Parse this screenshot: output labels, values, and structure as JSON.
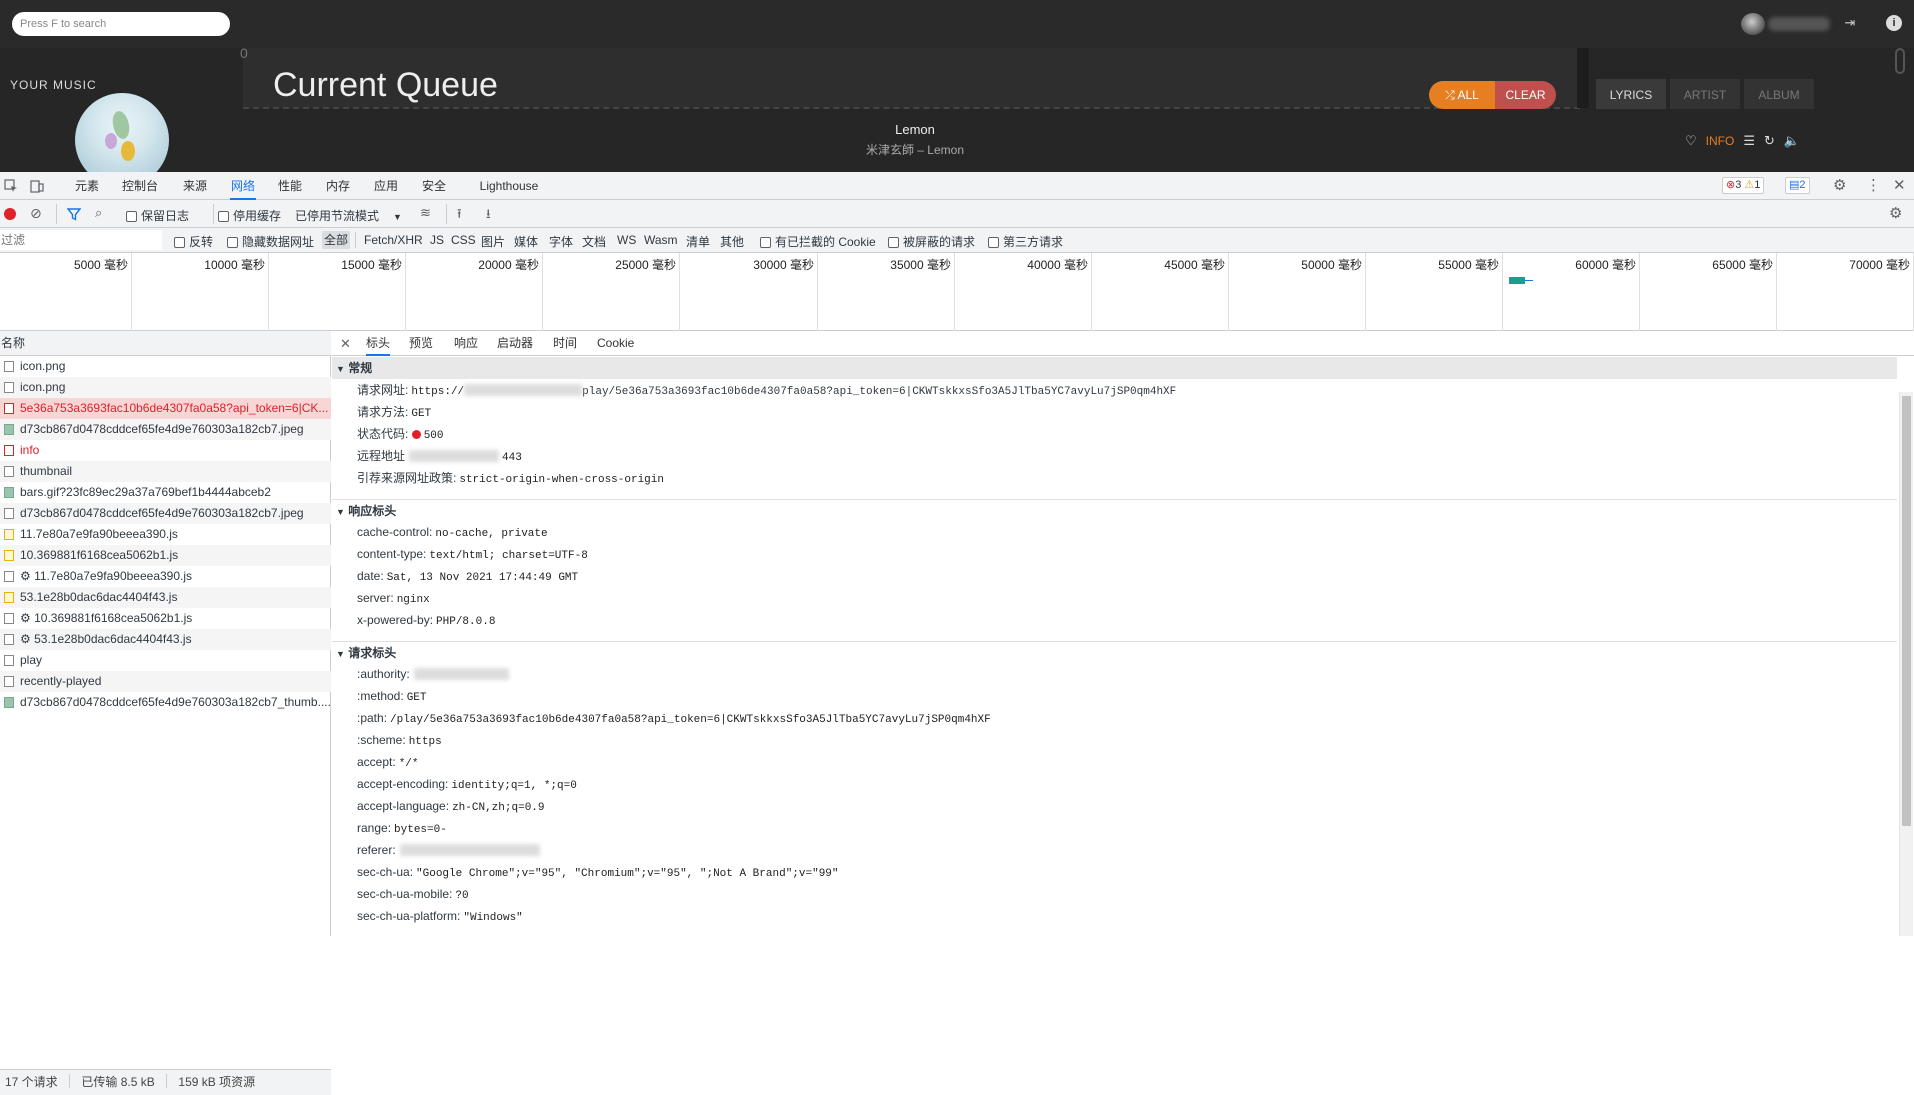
{
  "app": {
    "search_placeholder": "Press F to search",
    "your_music": "YOUR MUSIC",
    "queue_title": "Current Queue",
    "queue_zero": "0",
    "btn_all": "ALL",
    "btn_clear": "CLEAR",
    "tabs": [
      "LYRICS",
      "ARTIST",
      "ALBUM"
    ],
    "song_title": "Lemon",
    "song_sub": "米津玄師 – Lemon",
    "info_label": "INFO",
    "colors": {
      "accent": "#e67e22",
      "clear": "#c0504d",
      "bg": "#262626"
    }
  },
  "devtools": {
    "tabs": [
      "元素",
      "控制台",
      "来源",
      "网络",
      "性能",
      "内存",
      "应用",
      "安全",
      "Lighthouse"
    ],
    "active_tab": "网络",
    "badges": {
      "errors": "3",
      "warnings": "1",
      "messages": "2"
    },
    "toolbar": {
      "preserve_log": "保留日志",
      "disable_cache": "停用缓存",
      "throttle": "已停用节流模式"
    },
    "filter": {
      "placeholder": "过滤",
      "invert": "反转",
      "hide_data_urls": "隐藏数据网址",
      "types": [
        "全部",
        "Fetch/XHR",
        "JS",
        "CSS",
        "图片",
        "媒体",
        "字体",
        "文档",
        "WS",
        "Wasm",
        "清单",
        "其他"
      ],
      "blocked_cookies": "有已拦截的 Cookie",
      "blocked_requests": "被屏蔽的请求",
      "third_party": "第三方请求"
    },
    "timeline_ticks": [
      "5000 毫秒",
      "10000 毫秒",
      "15000 毫秒",
      "20000 毫秒",
      "25000 毫秒",
      "30000 毫秒",
      "35000 毫秒",
      "40000 毫秒",
      "45000 毫秒",
      "50000 毫秒",
      "55000 毫秒",
      "60000 毫秒",
      "65000 毫秒",
      "70000 毫秒"
    ],
    "list_header": "名称",
    "requests": [
      {
        "name": "icon.png",
        "kind": "doc"
      },
      {
        "name": "icon.png",
        "kind": "doc"
      },
      {
        "name": "5e36a753a3693fac10b6de4307fa0a58?api_token=6|CK...",
        "kind": "err"
      },
      {
        "name": "d73cb867d0478cddcef65fe4d9e760303a182cb7.jpeg",
        "kind": "img"
      },
      {
        "name": "info",
        "kind": "err"
      },
      {
        "name": "thumbnail",
        "kind": "doc"
      },
      {
        "name": "bars.gif?23fc89ec29a37a769bef1b4444abceb2",
        "kind": "img"
      },
      {
        "name": "d73cb867d0478cddcef65fe4d9e760303a182cb7.jpeg",
        "kind": "doc"
      },
      {
        "name": "11.7e80a7e9fa90beeea390.js",
        "kind": "js"
      },
      {
        "name": "10.369881f6168cea5062b1.js",
        "kind": "js"
      },
      {
        "name": "⚙ 11.7e80a7e9fa90beeea390.js",
        "kind": "doc"
      },
      {
        "name": "53.1e28b0dac6dac4404f43.js",
        "kind": "js"
      },
      {
        "name": "⚙ 10.369881f6168cea5062b1.js",
        "kind": "doc"
      },
      {
        "name": "⚙ 53.1e28b0dac6dac4404f43.js",
        "kind": "doc"
      },
      {
        "name": "play",
        "kind": "doc"
      },
      {
        "name": "recently-played",
        "kind": "doc"
      },
      {
        "name": "d73cb867d0478cddcef65fe4d9e760303a182cb7_thumb....",
        "kind": "img"
      }
    ],
    "status": {
      "requests": "17 个请求",
      "transferred": "已传输 8.5 kB",
      "resources": "159 kB 项资源"
    },
    "detail_tabs": [
      "标头",
      "预览",
      "响应",
      "启动器",
      "时间",
      "Cookie"
    ],
    "general": {
      "title": "常规",
      "url_label": "请求网址:",
      "url_prefix": "https://",
      "url_suffix": "play/5e36a753a3693fac10b6de4307fa0a58?api_token=6|CKWTskkxsSfo3A5JlTba5YC7avyLu7jSP0qm4hXF",
      "method_label": "请求方法:",
      "method": "GET",
      "status_label": "状态代码:",
      "status": "500",
      "remote_label": "远程地址",
      "remote_suffix": "443",
      "referrer_label": "引荐来源网址政策:",
      "referrer": "strict-origin-when-cross-origin"
    },
    "response_headers": {
      "title": "响应标头",
      "items": [
        {
          "k": "cache-control:",
          "v": "no-cache, private"
        },
        {
          "k": "content-type:",
          "v": "text/html; charset=UTF-8"
        },
        {
          "k": "date:",
          "v": "Sat, 13 Nov 2021 17:44:49 GMT"
        },
        {
          "k": "server:",
          "v": "nginx"
        },
        {
          "k": "x-powered-by:",
          "v": "PHP/8.0.8"
        }
      ]
    },
    "request_headers": {
      "title": "请求标头",
      "items": [
        {
          "k": ":authority:",
          "v": ""
        },
        {
          "k": ":method:",
          "v": "GET"
        },
        {
          "k": ":path:",
          "v": "/play/5e36a753a3693fac10b6de4307fa0a58?api_token=6|CKWTskkxsSfo3A5JlTba5YC7avyLu7jSP0qm4hXF"
        },
        {
          "k": ":scheme:",
          "v": "https"
        },
        {
          "k": "accept:",
          "v": "*/*"
        },
        {
          "k": "accept-encoding:",
          "v": "identity;q=1, *;q=0"
        },
        {
          "k": "accept-language:",
          "v": "zh-CN,zh;q=0.9"
        },
        {
          "k": "range:",
          "v": "bytes=0-"
        },
        {
          "k": "referer:",
          "v": ""
        },
        {
          "k": "sec-ch-ua:",
          "v": "\"Google Chrome\";v=\"95\", \"Chromium\";v=\"95\", \";Not A Brand\";v=\"99\""
        },
        {
          "k": "sec-ch-ua-mobile:",
          "v": "?0"
        },
        {
          "k": "sec-ch-ua-platform:",
          "v": "\"Windows\""
        }
      ]
    }
  }
}
